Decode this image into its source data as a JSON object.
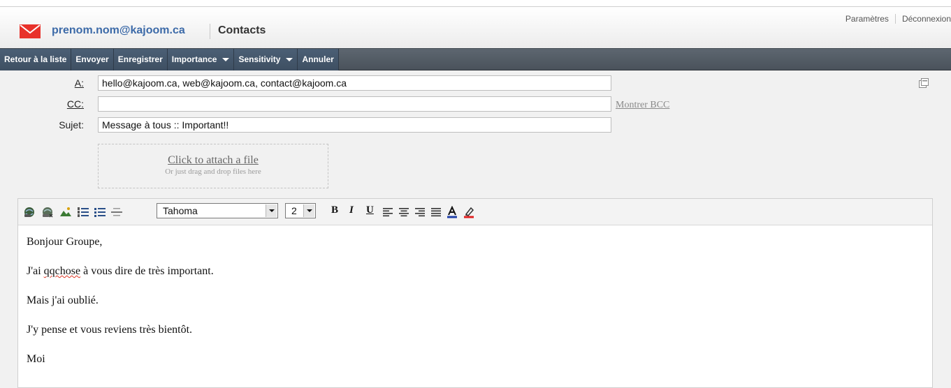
{
  "header": {
    "account_email": "prenom.nom@kajoom.ca",
    "section": "Contacts",
    "links": [
      "Paramètres",
      "Déconnexion"
    ]
  },
  "toolbar": {
    "back": "Retour à la liste",
    "send": "Envoyer",
    "save": "Enregistrer",
    "importance": "Importance",
    "sensitivity": "Sensitivity",
    "cancel": "Annuler"
  },
  "compose": {
    "to_label": "A:",
    "to_value": "hello@kajoom.ca, web@kajoom.ca, contact@kajoom.ca",
    "cc_label": "CC:",
    "cc_value": "",
    "subject_label": "Sujet:",
    "subject_value": "Message à tous :: Important!!",
    "show_bcc": "Montrer BCC",
    "attach_link": "Click to attach a file",
    "attach_hint": "Or just drag and drop files here"
  },
  "editor": {
    "font": "Tahoma",
    "size": "2",
    "format_labels": {
      "bold": "B",
      "italic": "I",
      "underline": "U"
    },
    "body": {
      "line1": "Bonjour Groupe,",
      "line2_pre": "J'ai ",
      "line2_misspelled": "qqchose",
      "line2_post": " à vous dire de très important.",
      "line3": "Mais j'ai oublié.",
      "line4": "J'y pense et vous reviens très bientôt.",
      "line5": "Moi"
    }
  },
  "icons": {
    "mail": "envelope-icon",
    "expand": "expand-window-icon",
    "toolbar": [
      "link-icon",
      "unlink-icon",
      "image-icon",
      "ordered-list-icon",
      "bullet-list-icon",
      "horizontal-rule-icon",
      "align-left-icon",
      "align-center-icon",
      "align-right-icon",
      "align-justify-icon",
      "text-color-icon",
      "highlight-color-icon"
    ]
  },
  "colors": {
    "toolbar_bg": "#4a525b",
    "toolbar_strip": "#3e4f62",
    "email_blue": "#3c6aa8",
    "mail_red": "#e8322b",
    "text_color_bar": "#1f3fa8",
    "highlight_bar": "#e02020"
  }
}
